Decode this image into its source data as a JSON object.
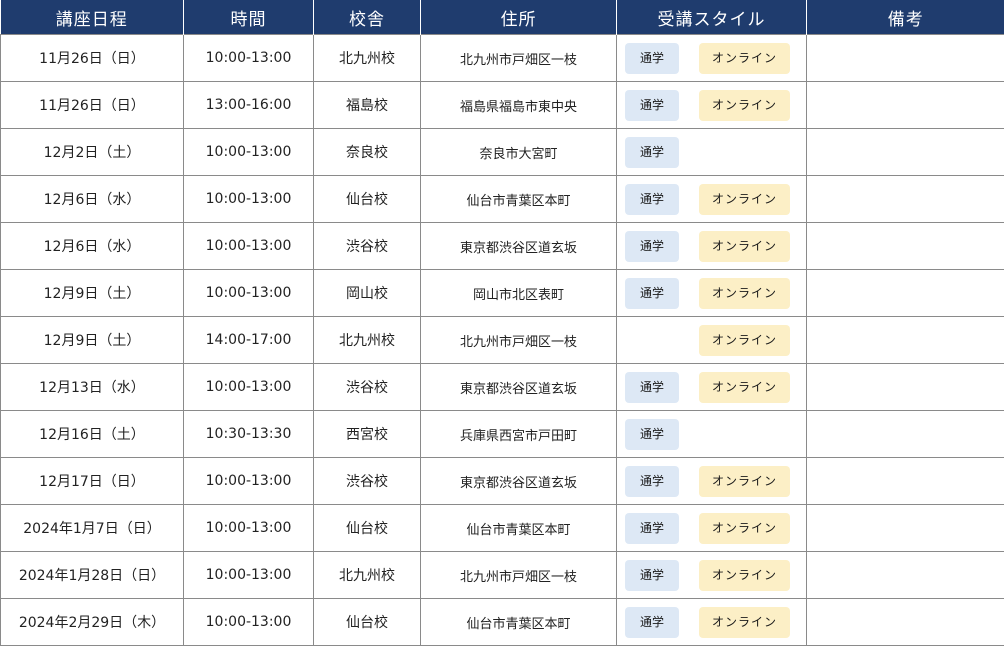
{
  "headers": {
    "date": "講座日程",
    "time": "時間",
    "school": "校舎",
    "address": "住所",
    "style": "受講スタイル",
    "notes": "備考"
  },
  "badges": {
    "commute": "通学",
    "online": "オンライン"
  },
  "colors": {
    "header_bg": "#1f3c6e",
    "commute_bg": "#dde8f5",
    "online_bg": "#fcefc6",
    "grid": "#8a8a8a"
  },
  "rows": [
    {
      "date": "11月26日（日）",
      "time": "10:00-13:00",
      "school": "北九州校",
      "address": "北九州市戸畑区一枝",
      "commute": true,
      "online": true,
      "notes": ""
    },
    {
      "date": "11月26日（日）",
      "time": "13:00-16:00",
      "school": "福島校",
      "address": "福島県福島市東中央",
      "commute": true,
      "online": true,
      "notes": ""
    },
    {
      "date": "12月2日（土）",
      "time": "10:00-13:00",
      "school": "奈良校",
      "address": "奈良市大宮町",
      "commute": true,
      "online": false,
      "notes": ""
    },
    {
      "date": "12月6日（水）",
      "time": "10:00-13:00",
      "school": "仙台校",
      "address": "仙台市青葉区本町",
      "commute": true,
      "online": true,
      "notes": ""
    },
    {
      "date": "12月6日（水）",
      "time": "10:00-13:00",
      "school": "渋谷校",
      "address": "東京都渋谷区道玄坂",
      "commute": true,
      "online": true,
      "notes": ""
    },
    {
      "date": "12月9日（土）",
      "time": "10:00-13:00",
      "school": "岡山校",
      "address": "岡山市北区表町",
      "commute": true,
      "online": true,
      "notes": ""
    },
    {
      "date": "12月9日（土）",
      "time": "14:00-17:00",
      "school": "北九州校",
      "address": "北九州市戸畑区一枝",
      "commute": false,
      "online": true,
      "notes": ""
    },
    {
      "date": "12月13日（水）",
      "time": "10:00-13:00",
      "school": "渋谷校",
      "address": "東京都渋谷区道玄坂",
      "commute": true,
      "online": true,
      "notes": ""
    },
    {
      "date": "12月16日（土）",
      "time": "10:30-13:30",
      "school": "西宮校",
      "address": "兵庫県西宮市戸田町",
      "commute": true,
      "online": false,
      "notes": ""
    },
    {
      "date": "12月17日（日）",
      "time": "10:00-13:00",
      "school": "渋谷校",
      "address": "東京都渋谷区道玄坂",
      "commute": true,
      "online": true,
      "notes": ""
    },
    {
      "date": "2024年1月7日（日）",
      "time": "10:00-13:00",
      "school": "仙台校",
      "address": "仙台市青葉区本町",
      "commute": true,
      "online": true,
      "notes": ""
    },
    {
      "date": "2024年1月28日（日）",
      "time": "10:00-13:00",
      "school": "北九州校",
      "address": "北九州市戸畑区一枝",
      "commute": true,
      "online": true,
      "notes": ""
    },
    {
      "date": "2024年2月29日（木）",
      "time": "10:00-13:00",
      "school": "仙台校",
      "address": "仙台市青葉区本町",
      "commute": true,
      "online": true,
      "notes": ""
    }
  ]
}
